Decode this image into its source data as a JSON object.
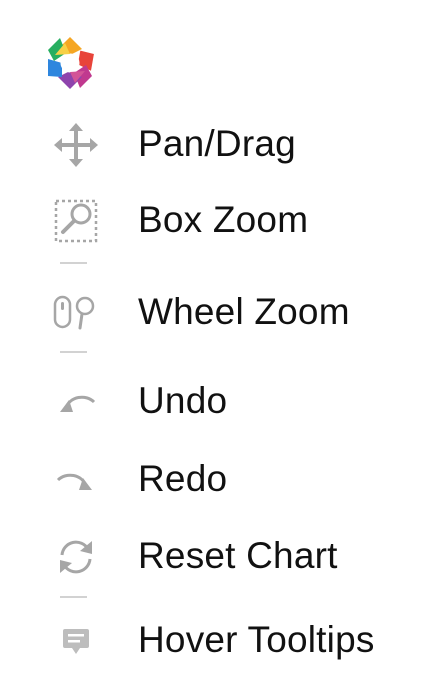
{
  "toolbar": {
    "logo_icon": "bokeh-logo-icon",
    "items": [
      {
        "label": "Pan/Drag",
        "icon": "pan-drag-icon"
      },
      {
        "label": "Box Zoom",
        "icon": "box-zoom-icon"
      },
      {
        "label": "Wheel Zoom",
        "icon": "wheel-zoom-icon"
      },
      {
        "label": "Undo",
        "icon": "undo-icon"
      },
      {
        "label": "Redo",
        "icon": "redo-icon"
      },
      {
        "label": "Reset Chart",
        "icon": "reset-icon"
      },
      {
        "label": "Hover Tooltips",
        "icon": "hover-tooltip-icon"
      }
    ]
  },
  "colors": {
    "icon_gray": "#a6a6a6",
    "divider": "#d2d2d2",
    "text": "#111111",
    "logo": [
      "#f7b32b",
      "#e8443a",
      "#8e44ad",
      "#3a8ee6",
      "#2ecc71",
      "#f39c12"
    ]
  }
}
